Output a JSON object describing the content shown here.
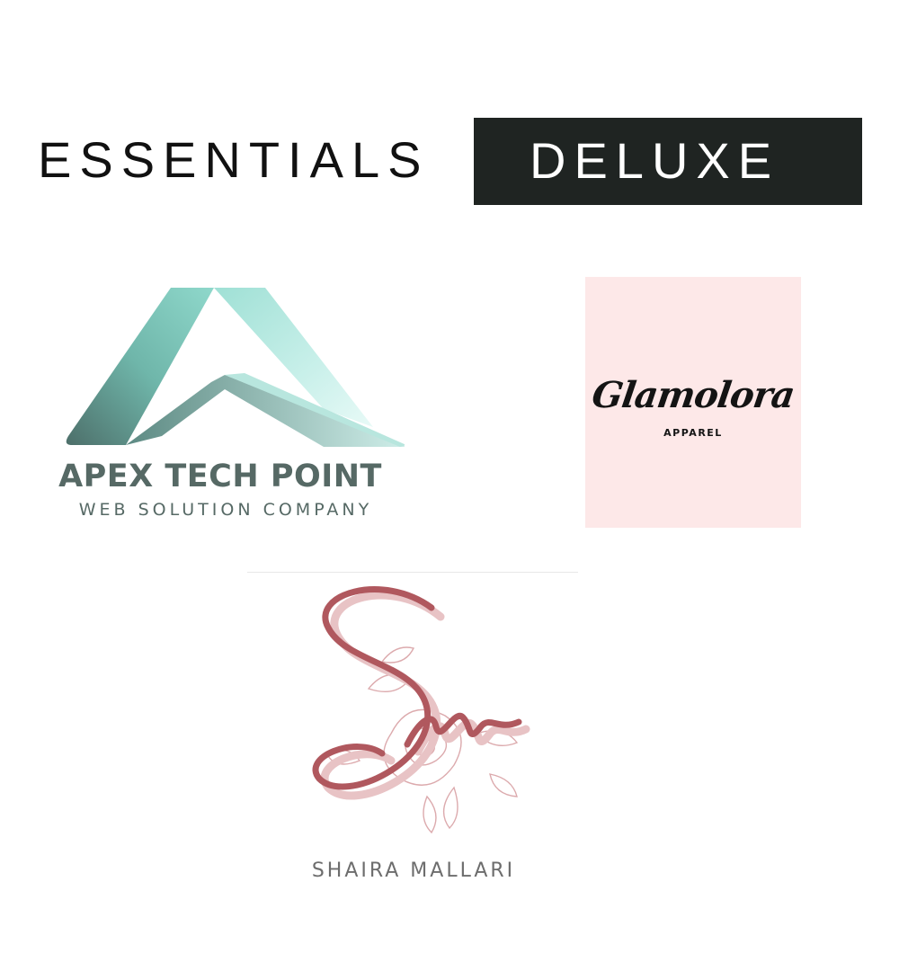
{
  "header": {
    "plain_title": "ESSENTIALS",
    "boxed_title": "DELUXE",
    "box_color": "#1f2422"
  },
  "logos": {
    "apex": {
      "name": "APEX TECH POINT",
      "tagline": "WEB SOLUTION COMPANY",
      "text_color": "#566965",
      "mark_icon": "apex-triangle-icon"
    },
    "glamolora": {
      "name": "Glamolora",
      "subtitle": "APPAREL",
      "background": "#fde8e8"
    },
    "shaira": {
      "monogram": "Sm",
      "name": "SHAIRA MALLARI",
      "accent": "#b0585e"
    }
  }
}
